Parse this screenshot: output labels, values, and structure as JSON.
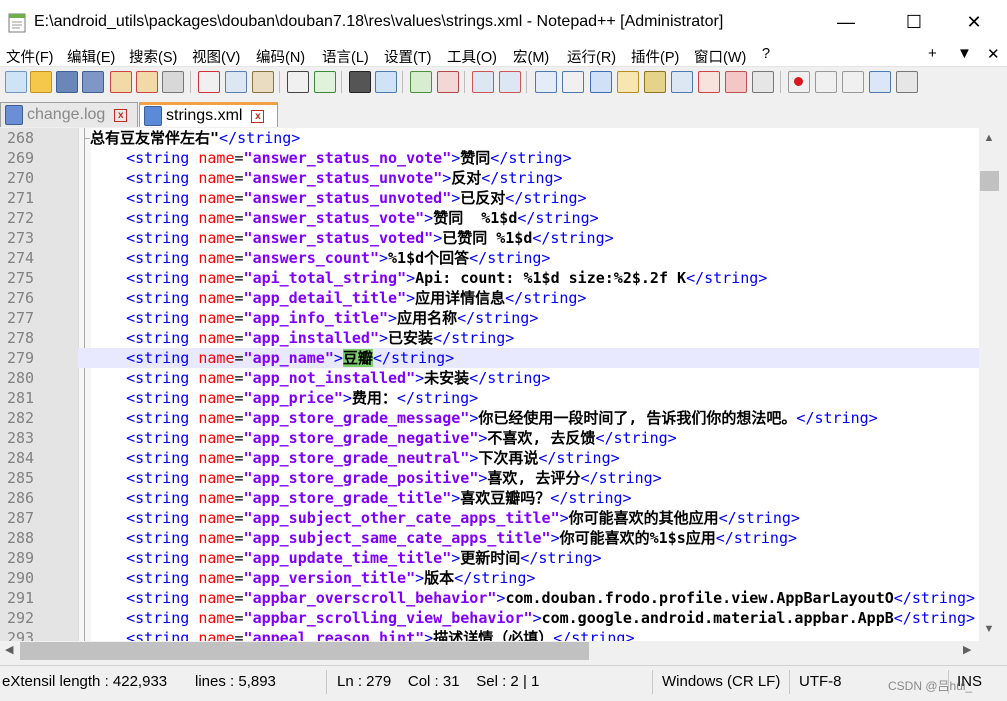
{
  "window": {
    "title": "E:\\android_utils\\packages\\douban\\douban7.18\\res\\values\\strings.xml - Notepad++ [Administrator]",
    "minimize": "—",
    "maximize": "☐",
    "close": "✕"
  },
  "menu": {
    "items": [
      "文件(F)",
      "编辑(E)",
      "搜索(S)",
      "视图(V)",
      "编码(N)",
      "语言(L)",
      "设置(T)",
      "工具(O)",
      "宏(M)",
      "运行(R)",
      "插件(P)",
      "窗口(W)",
      "?"
    ],
    "plus": "+",
    "dropdown": "▼",
    "close": "✕"
  },
  "tabs": [
    {
      "label": "change.log",
      "close": "x",
      "active": false
    },
    {
      "label": "strings.xml",
      "close": "x",
      "active": true
    }
  ],
  "editor": {
    "current_line": 279,
    "lines": [
      {
        "num": "268",
        "text": "总有豆友常伴左右\"</string>"
      },
      {
        "num": "269",
        "name": "answer_status_no_vote",
        "value": "赞同"
      },
      {
        "num": "270",
        "name": "answer_status_unvote",
        "value": "反对"
      },
      {
        "num": "271",
        "name": "answer_status_unvoted",
        "value": "已反对"
      },
      {
        "num": "272",
        "name": "answer_status_vote",
        "value": "赞同  %1$d"
      },
      {
        "num": "273",
        "name": "answer_status_voted",
        "value": "已赞同 %1$d"
      },
      {
        "num": "274",
        "name": "answers_count",
        "value": "%1$d个回答"
      },
      {
        "num": "275",
        "name": "api_total_string",
        "value": "Api: count: %1$d size:%2$.2f K"
      },
      {
        "num": "276",
        "name": "app_detail_title",
        "value": "应用详情信息"
      },
      {
        "num": "277",
        "name": "app_info_title",
        "value": "应用名称"
      },
      {
        "num": "278",
        "name": "app_installed",
        "value": "已安装"
      },
      {
        "num": "279",
        "name": "app_name",
        "value": "豆瓣"
      },
      {
        "num": "280",
        "name": "app_not_installed",
        "value": "未安装"
      },
      {
        "num": "281",
        "name": "app_price",
        "value": "费用："
      },
      {
        "num": "282",
        "name": "app_store_grade_message",
        "value": "你已经使用一段时间了, 告诉我们你的想法吧。"
      },
      {
        "num": "283",
        "name": "app_store_grade_negative",
        "value": "不喜欢, 去反馈"
      },
      {
        "num": "284",
        "name": "app_store_grade_neutral",
        "value": "下次再说"
      },
      {
        "num": "285",
        "name": "app_store_grade_positive",
        "value": "喜欢, 去评分"
      },
      {
        "num": "286",
        "name": "app_store_grade_title",
        "value": "喜欢豆瓣吗？"
      },
      {
        "num": "287",
        "name": "app_subject_other_cate_apps_title",
        "value": "你可能喜欢的其他应用"
      },
      {
        "num": "288",
        "name": "app_subject_same_cate_apps_title",
        "value": "你可能喜欢的%1$s应用"
      },
      {
        "num": "289",
        "name": "app_update_time_title",
        "value": "更新时间"
      },
      {
        "num": "290",
        "name": "app_version_title",
        "value": "版本"
      },
      {
        "num": "291",
        "name": "appbar_overscroll_behavior",
        "value": "com.douban.frodo.profile.view.AppBarLayoutO"
      },
      {
        "num": "292",
        "name": "appbar_scrolling_view_behavior",
        "value": "com.google.android.material.appbar.AppB"
      },
      {
        "num": "293",
        "name": "appeal_reason_hint",
        "value": "描述详情（必填）"
      }
    ]
  },
  "status": {
    "file_type": "eXtensil length : 422,933",
    "lines": "lines : 5,893",
    "position": "Ln : 279    Col : 31    Sel : 2 | 1",
    "eol": "Windows (CR LF)",
    "encoding": "UTF-8",
    "mode": "INS"
  },
  "watermark": "CSDN @吕hui_"
}
